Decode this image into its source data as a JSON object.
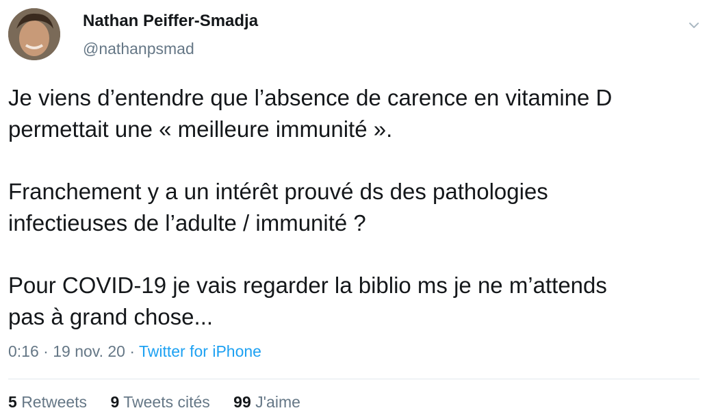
{
  "author": {
    "name": "Nathan Peiffer-Smadja",
    "handle": "@nathanpsmad"
  },
  "tweet": {
    "paragraphs": [
      [
        "Je viens d’entendre que l’absence de carence en vitamine D",
        "permettait une « meilleure immunité »."
      ],
      [
        "Franchement y a un intérêt prouvé ds des pathologies",
        "infectieuses de l’adulte / immunité ?"
      ],
      [
        "Pour COVID-19 je vais regarder la biblio ms je ne m’attends",
        "pas à grand chose..."
      ]
    ]
  },
  "meta": {
    "time": "0:16",
    "separator": "·",
    "date": "19 nov. 20",
    "source": "Twitter for iPhone"
  },
  "stats": {
    "retweets_count": "5",
    "retweets_label": "Retweets",
    "quotes_count": "9",
    "quotes_label": "Tweets cités",
    "likes_count": "99",
    "likes_label": "J'aime"
  },
  "icons": {
    "menu": "chevron-down-icon"
  },
  "colors": {
    "text": "#14171a",
    "secondary": "#657786",
    "link": "#1da1f2",
    "divider": "#e1e8ed"
  }
}
